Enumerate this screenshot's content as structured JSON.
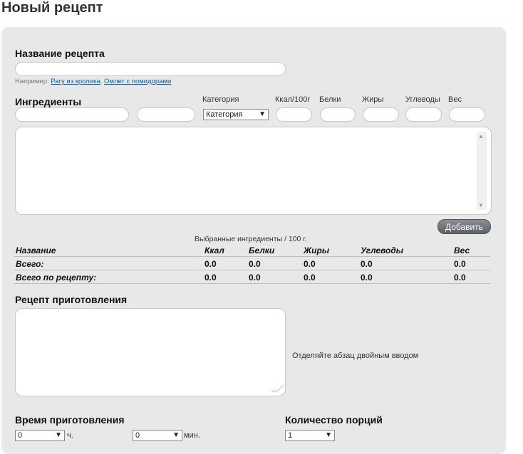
{
  "page": {
    "title": "Новый рецепт"
  },
  "recipe_name": {
    "label": "Название рецепта",
    "value": "",
    "hint_prefix": "Например:",
    "examples": [
      "Рагу из кролика",
      "Омлет с помидорами"
    ],
    "separator": ","
  },
  "ingredients": {
    "label": "Ингредиенты",
    "columns": {
      "category": "Категория",
      "kcal": "Ккал/100г",
      "protein": "Белки",
      "fat": "Жиры",
      "carbs": "Углеводы",
      "weight": "Вес"
    },
    "category_select": "Категория",
    "add_button": "Добавить"
  },
  "selected_table": {
    "caption": "Выбранные ингредиенты / 100 г.",
    "headers": [
      "Название",
      "Ккал",
      "Белки",
      "Жиры",
      "Углеводы",
      "Вес"
    ],
    "rows": [
      {
        "name": "Всего:",
        "values": [
          "0.0",
          "0.0",
          "0.0",
          "0.0",
          "0.0"
        ]
      },
      {
        "name": "Всего по рецепту:",
        "values": [
          "0.0",
          "0.0",
          "0.0",
          "0.0",
          "0.0"
        ]
      }
    ]
  },
  "recipe_text": {
    "label": "Рецепт приготовления",
    "value": "",
    "hint": "Отделяйте абзац двойным вводом"
  },
  "cooking_time": {
    "label": "Время приготовления",
    "hours_value": "0",
    "hours_unit": "ч.",
    "minutes_value": "0",
    "minutes_unit": "мин."
  },
  "servings": {
    "label": "Количество порций",
    "value": "1"
  }
}
